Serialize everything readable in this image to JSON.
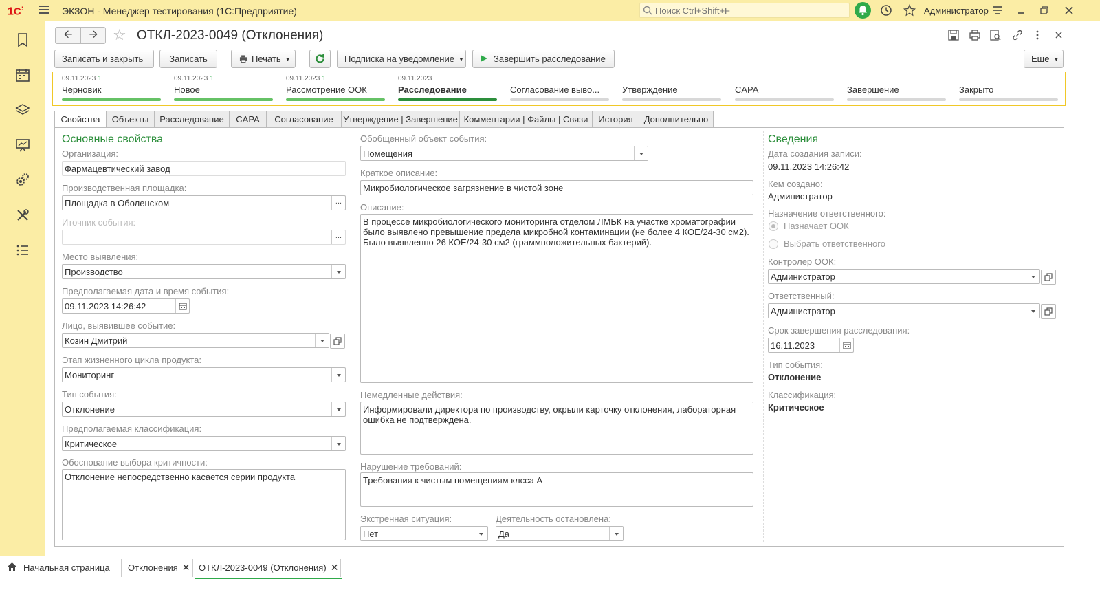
{
  "app": {
    "title": "ЭКЗОН  - Менеджер тестирования (1С:Предприятие)",
    "search_placeholder": "Поиск Ctrl+Shift+F",
    "user": "Администратор"
  },
  "form": {
    "title": "ОТКЛ-2023-0049 (Отклонения)"
  },
  "toolbar": {
    "save_close": "Записать и закрыть",
    "save": "Записать",
    "print": "Печать",
    "subscribe": "Подписка на уведомление",
    "finish": "Завершить расследование",
    "more": "Еще"
  },
  "stages": [
    {
      "date": "09.11.2023",
      "count": "1",
      "name": "Черновик",
      "state": "done"
    },
    {
      "date": "09.11.2023",
      "count": "1",
      "name": "Новое",
      "state": "done"
    },
    {
      "date": "09.11.2023",
      "count": "1",
      "name": "Рассмотрение ООК",
      "state": "done"
    },
    {
      "date": "09.11.2023",
      "count": "",
      "name": "Расследование",
      "state": "current"
    },
    {
      "date": "",
      "count": "",
      "name": "Согласование выво...",
      "state": "pending"
    },
    {
      "date": "",
      "count": "",
      "name": "Утверждение",
      "state": "pending"
    },
    {
      "date": "",
      "count": "",
      "name": "CAPA",
      "state": "pending"
    },
    {
      "date": "",
      "count": "",
      "name": "Завершение",
      "state": "pending"
    },
    {
      "date": "",
      "count": "",
      "name": "Закрыто",
      "state": "pending"
    }
  ],
  "tabs": [
    "Свойства",
    "Объекты",
    "Расследование",
    "CAPA",
    "Согласование",
    "Утверждение | Завершение",
    "Комментарии | Файлы | Связи",
    "История",
    "Дополнительно"
  ],
  "left": {
    "section": "Основные свойства",
    "org_label": "Организация:",
    "org_value": "Фармацевтический завод",
    "site_label": "Производственная площадка:",
    "site_value": "Площадка в Оболенском",
    "source_label": "Иточник события:",
    "source_value": "",
    "place_label": "Место выявления:",
    "place_value": "Производство",
    "date_label": "Предполагаемая дата и время события:",
    "date_value": "09.11.2023 14:26:42",
    "person_label": "Лицо, выявившее событие:",
    "person_value": "Козин Дмитрий",
    "stage_label": "Этап жизненного цикла продукта:",
    "stage_value": "Мониторинг",
    "type_label": "Тип события:",
    "type_value": "Отклонение",
    "class_label": "Предполагаемая классификация:",
    "class_value": "Критическое",
    "reason_label": "Обоснование выбора критичности:",
    "reason_value": "Отклонение непосредственно касается серии продукта"
  },
  "middle": {
    "object_label": "Обобщенный объект события:",
    "object_value": "Помещения",
    "short_label": "Краткое описание:",
    "short_value": "Микробиологическое загрязнение в чистой зоне",
    "desc_label": "Описание:",
    "desc_value": "В процессе микробиологического мониторинга отделом ЛМБК на участке хроматографии\nбыло выявлено превышение предела микробной контаминации (не более 4 КОЕ/24-30 см2).\nБыло выявленно 26 КОЕ/24-30 см2 (граммположительных бактерий).",
    "actions_label": "Немедленные действия:",
    "actions_value": "Информировали директора по производству, окрыли карточку отклонения, лабораторная\nошибка не подтверждена.",
    "violation_label": "Нарушение требований:",
    "violation_value": "Требования к чистым помещениям клсса А",
    "emergency_label": "Экстренная ситуация:",
    "emergency_value": "Нет",
    "stopped_label": "Деятельность остановлена:",
    "stopped_value": "Да"
  },
  "right": {
    "section": "Сведения",
    "created_label": "Дата создания записи:",
    "created_value": "09.11.2023 14:26:42",
    "author_label": "Кем создано:",
    "author_value": "Администратор",
    "assign_label": "Назначение ответственного:",
    "radio1": "Назначает ООК",
    "radio2": "Выбрать ответственного",
    "controller_label": "Контролер ООК:",
    "controller_value": "Администратор",
    "resp_label": "Ответственный:",
    "resp_value": "Администратор",
    "deadline_label": "Срок завершения расследования:",
    "deadline_value": "16.11.2023",
    "evtype_label": "Тип события:",
    "evtype_value": "Отклонение",
    "classif_label": "Классификация:",
    "classif_value": "Критическое"
  },
  "bottom_tabs": {
    "home": "Начальная страница",
    "list": "Отклонения",
    "current": "ОТКЛ-2023-0049 (Отклонения)"
  }
}
